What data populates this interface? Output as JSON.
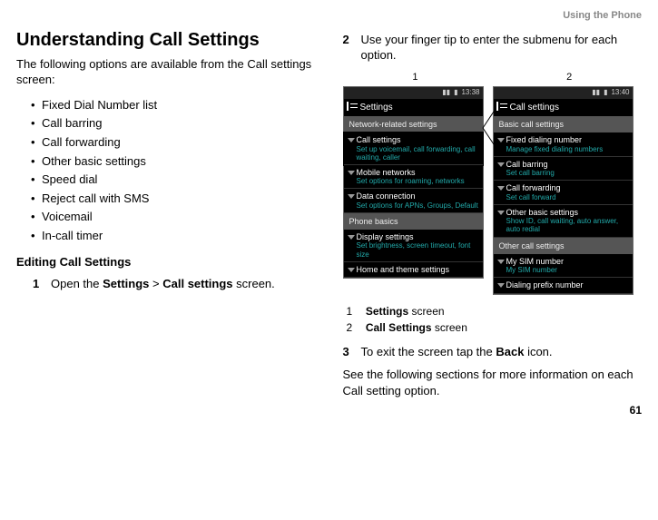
{
  "header": "Using the Phone",
  "pageNumber": "61",
  "left": {
    "title": "Understanding Call Settings",
    "intro": "The following options are available from the Call settings screen:",
    "bullets": [
      "Fixed Dial Number list",
      "Call barring",
      "Call forwarding",
      "Other basic settings",
      "Speed dial",
      "Reject call with SMS",
      "Voicemail",
      "In-call timer"
    ],
    "editHeading": "Editing Call Settings",
    "step1": {
      "n": "1",
      "pre": "Open the ",
      "b1": "Settings",
      "mid": " > ",
      "b2": "Call settings",
      "post": " screen."
    }
  },
  "right": {
    "step2": {
      "n": "2",
      "text": "Use your finger tip to enter the submenu for each option."
    },
    "figLabels": {
      "a": "1",
      "b": "2"
    },
    "screen1": {
      "time": "13:38",
      "title": "Settings",
      "sec1": "Network-related settings",
      "i1": {
        "t": "Call settings",
        "s": "Set up voicemail, call forwarding, call waiting, caller"
      },
      "i2": {
        "t": "Mobile networks",
        "s": "Set options for roaming, networks"
      },
      "i3": {
        "t": "Data connection",
        "s": "Set options for APNs, Groups, Default"
      },
      "sec2": "Phone basics",
      "i4": {
        "t": "Display settings",
        "s": "Set brightness, screen timeout, font size"
      },
      "i5": {
        "t": "Home and theme settings",
        "s": ""
      }
    },
    "screen2": {
      "time": "13:40",
      "title": "Call settings",
      "sec1": "Basic call settings",
      "i1": {
        "t": "Fixed dialing number",
        "s": "Manage fixed dialing numbers"
      },
      "i2": {
        "t": "Call barring",
        "s": "Set call barring"
      },
      "i3": {
        "t": "Call forwarding",
        "s": "Set call forward"
      },
      "i4": {
        "t": "Other basic settings",
        "s": "Show ID, call waiting, auto answer, auto redial"
      },
      "sec2": "Other call settings",
      "i5": {
        "t": "My SIM number",
        "s": "My SIM number"
      },
      "i6": {
        "t": "Dialing prefix number",
        "s": ""
      }
    },
    "legend": {
      "r1": {
        "n": "1",
        "b": "Settings",
        "post": " screen"
      },
      "r2": {
        "n": "2",
        "b": "Call Settings",
        "post": " screen"
      }
    },
    "step3": {
      "n": "3",
      "pre": "To exit the screen tap the ",
      "b": "Back",
      "post": " icon."
    },
    "closing": "See the following sections for more information on each Call setting option."
  }
}
